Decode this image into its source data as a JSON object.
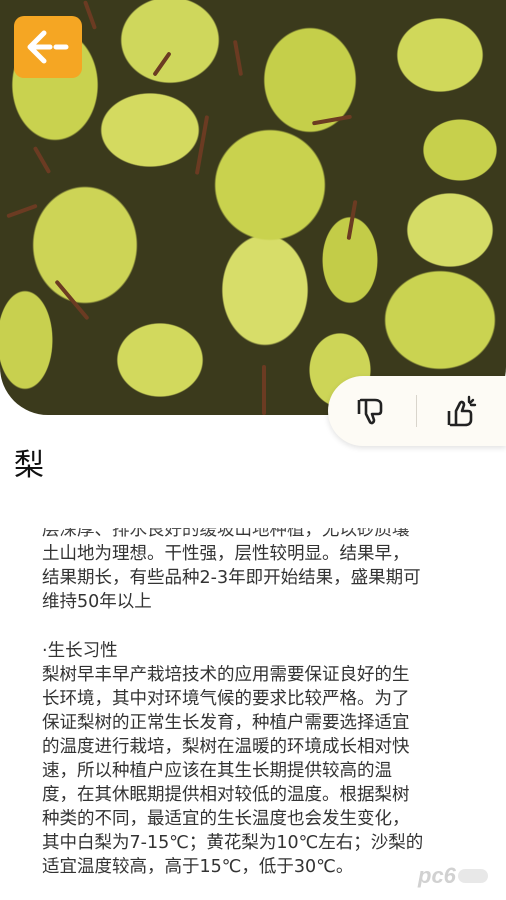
{
  "colors": {
    "accent": "#f5a623",
    "text": "#333333",
    "title": "#111111"
  },
  "header": {
    "back_icon": "arrow-left-icon"
  },
  "vote": {
    "dislike_icon": "thumbs-down-icon",
    "like_icon": "thumbs-up-icon"
  },
  "article": {
    "title": "梨",
    "lines_intro": [
      "层深厚、排水良好的缓坡山地种植，尤以砂质壤",
      "土山地为理想。干性强，层性较明显。结果早，",
      "结果期长，有些品种2-3年即开始结果，盛果期可",
      "维持50年以上"
    ],
    "section_heading": "·生长习性",
    "lines_section": [
      "梨树早丰早产栽培技术的应用需要保证良好的生",
      "长环境，其中对环境气候的要求比较严格。为了",
      "保证梨树的正常生长发育，种植户需要选择适宜",
      "的温度进行栽培，梨树在温暖的环境成长相对快",
      "速，所以种植户应该在其生长期提供较高的温",
      "度，在其休眠期提供相对较低的温度。根据梨树",
      "种类的不同，最适宜的生长温度也会发生变化，",
      "其中白梨为7-15℃；黄花梨为10℃左右；沙梨的",
      "适宜温度较高，高于15℃，低于30℃。"
    ]
  },
  "watermark": {
    "text": "pc6"
  }
}
